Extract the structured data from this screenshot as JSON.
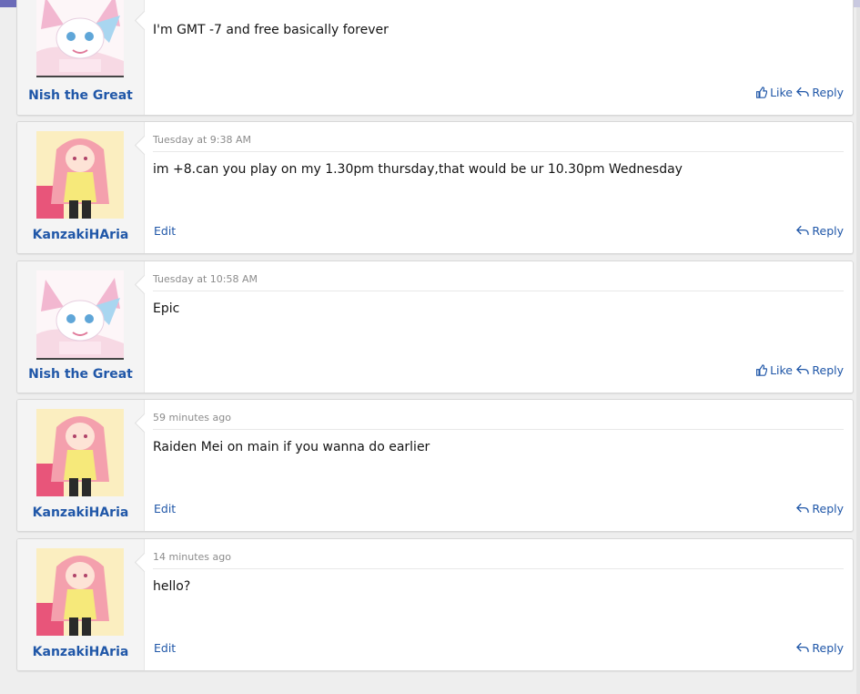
{
  "labels": {
    "like": "Like",
    "reply": "Reply",
    "edit": "Edit"
  },
  "posts": [
    {
      "username": "Nish the Great",
      "avatar": "sylveon-avatar",
      "time": "",
      "text": "I'm GMT -7 and free basically forever",
      "own": false
    },
    {
      "username": "KanzakiHAria",
      "avatar": "anime-girl-avatar",
      "time": "Tuesday at 9:38 AM",
      "text": "im +8.can you play on my 1.30pm thursday,that would be ur 10.30pm Wednesday",
      "own": true
    },
    {
      "username": "Nish the Great",
      "avatar": "sylveon-avatar",
      "time": "Tuesday at 10:58 AM",
      "text": "Epic",
      "own": false
    },
    {
      "username": "KanzakiHAria",
      "avatar": "anime-girl-avatar",
      "time": "59 minutes ago",
      "text": "Raiden Mei on main if you wanna do earlier",
      "own": true
    },
    {
      "username": "KanzakiHAria",
      "avatar": "anime-girl-avatar",
      "time": "14 minutes ago",
      "text": "hello?",
      "own": true
    }
  ],
  "colors": {
    "accent": "#2057a8",
    "top_bar": "#6b6bb8"
  }
}
